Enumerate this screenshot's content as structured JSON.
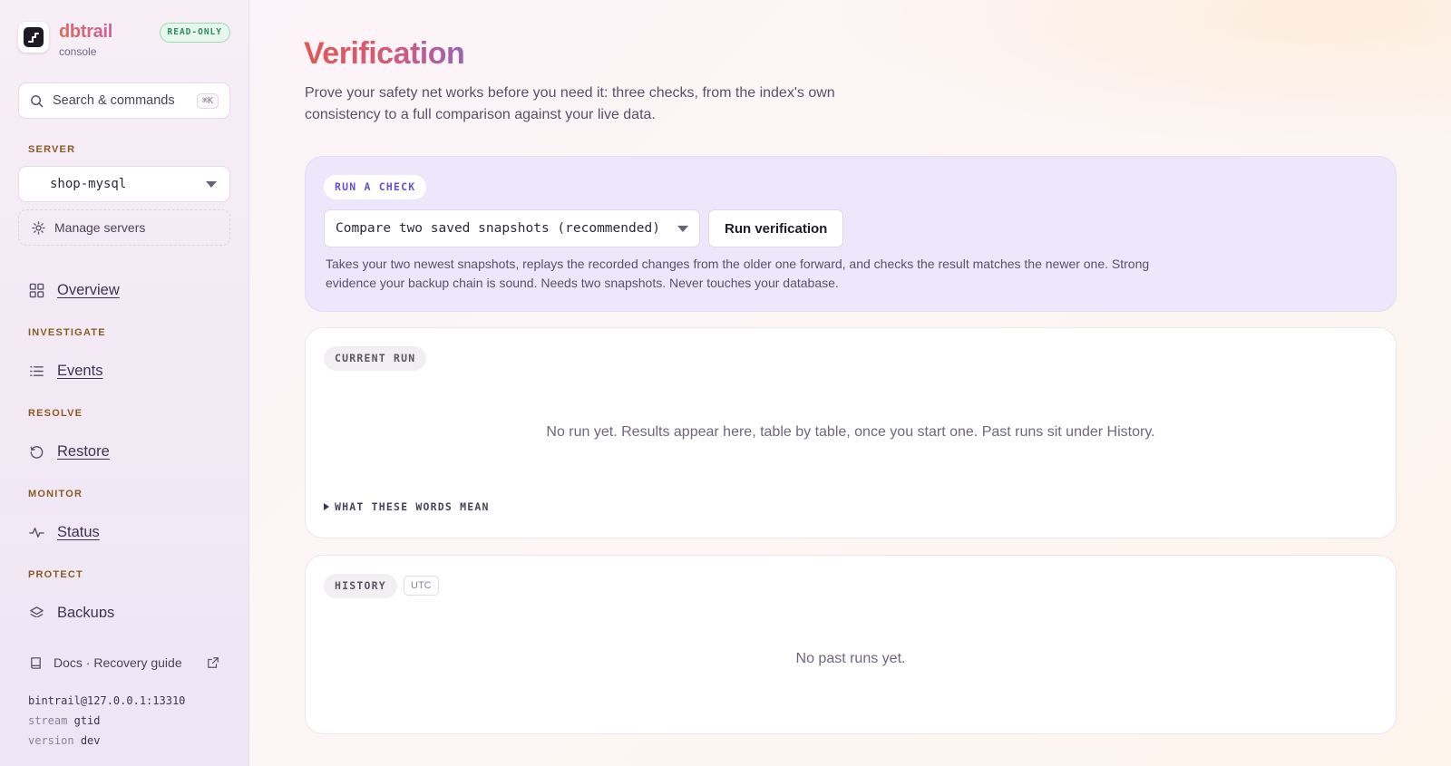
{
  "brand": {
    "name": "dbtrail",
    "subtitle": "console",
    "badge": "READ-ONLY",
    "badge_color": "#2f8a5f"
  },
  "search": {
    "label": "Search & commands",
    "shortcut": "⌘K"
  },
  "sidebar": {
    "server_section": "SERVER",
    "server_value": "shop-mysql",
    "manage_servers": "Manage servers",
    "overview": "Overview",
    "sections": [
      {
        "label": "INVESTIGATE",
        "item": "Events",
        "icon": "list-icon"
      },
      {
        "label": "RESOLVE",
        "item": "Restore",
        "icon": "history-icon"
      },
      {
        "label": "MONITOR",
        "item": "Status",
        "icon": "pulse-icon"
      },
      {
        "label": "PROTECT",
        "item": "Backups",
        "icon": "layers-icon"
      }
    ],
    "docs_link": "Docs · Recovery guide",
    "footer": {
      "connection": "bintrail@127.0.0.1:13310",
      "stream_key": "stream",
      "stream_value": "gtid",
      "version_key": "version",
      "version_value": "dev"
    }
  },
  "main": {
    "title": "Verification",
    "description": "Prove your safety net works before you need it: three checks, from the index's own consistency to a full comparison against your live data.",
    "run_check": {
      "label": "RUN A CHECK",
      "selected_check": "Compare two saved snapshots (recommended)",
      "button": "Run verification",
      "help": "Takes your two newest snapshots, replays the recorded changes from the older one forward, and checks the result matches the newer one. Strong evidence your backup chain is sound. Needs two snapshots. Never touches your database."
    },
    "current_run": {
      "label": "CURRENT RUN",
      "empty": "No run yet. Results appear here, table by table, once you start one. Past runs sit under History.",
      "glossary_toggle": "WHAT THESE WORDS MEAN"
    },
    "history": {
      "label": "HISTORY",
      "tz_badge": "UTC",
      "empty": "No past runs yet."
    }
  },
  "colors": {
    "accent_violet": "#6a4fcf",
    "section_label": "#8a5b21",
    "run_card_bg": "#ede7fb"
  }
}
